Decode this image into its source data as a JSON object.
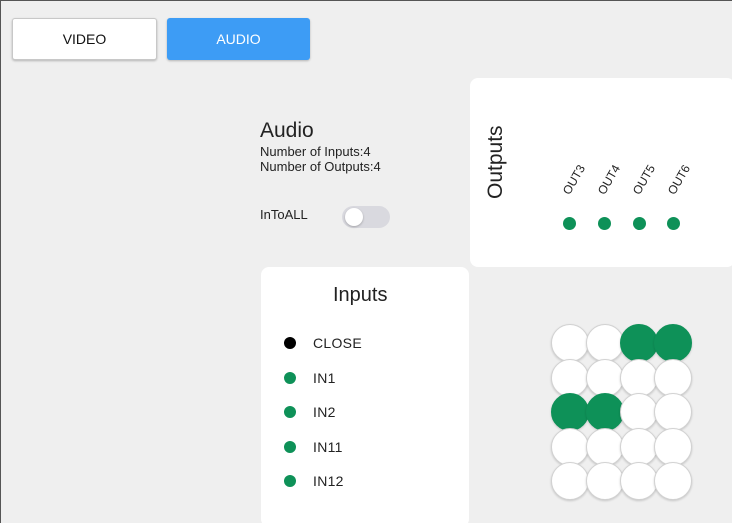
{
  "tabs": {
    "video": "VIDEO",
    "audio": "AUDIO"
  },
  "info": {
    "title": "Audio",
    "inputs_line": "Number of Inputs:4",
    "outputs_line": "Number of Outputs:4"
  },
  "intoall": {
    "label": "InToALL",
    "enabled": false
  },
  "outputs": {
    "title": "Outputs",
    "items": [
      {
        "label": "OUT3",
        "color": "#0e9158"
      },
      {
        "label": "OUT4",
        "color": "#0e9158"
      },
      {
        "label": "OUT5",
        "color": "#0e9158"
      },
      {
        "label": "OUT6",
        "color": "#0e9158"
      }
    ]
  },
  "inputs": {
    "title": "Inputs",
    "items": [
      {
        "label": "CLOSE",
        "color": "#000000"
      },
      {
        "label": "IN1",
        "color": "#0e9158"
      },
      {
        "label": "IN2",
        "color": "#0e9158"
      },
      {
        "label": "IN11",
        "color": "#0e9158"
      },
      {
        "label": "IN12",
        "color": "#0e9158"
      }
    ]
  },
  "matrix": {
    "on_color": "#0e9158",
    "off_color": "#ffffff",
    "rows": [
      [
        false,
        false,
        true,
        true
      ],
      [
        false,
        false,
        false,
        false
      ],
      [
        true,
        true,
        false,
        false
      ],
      [
        false,
        false,
        false,
        false
      ],
      [
        false,
        false,
        false,
        false
      ]
    ]
  }
}
